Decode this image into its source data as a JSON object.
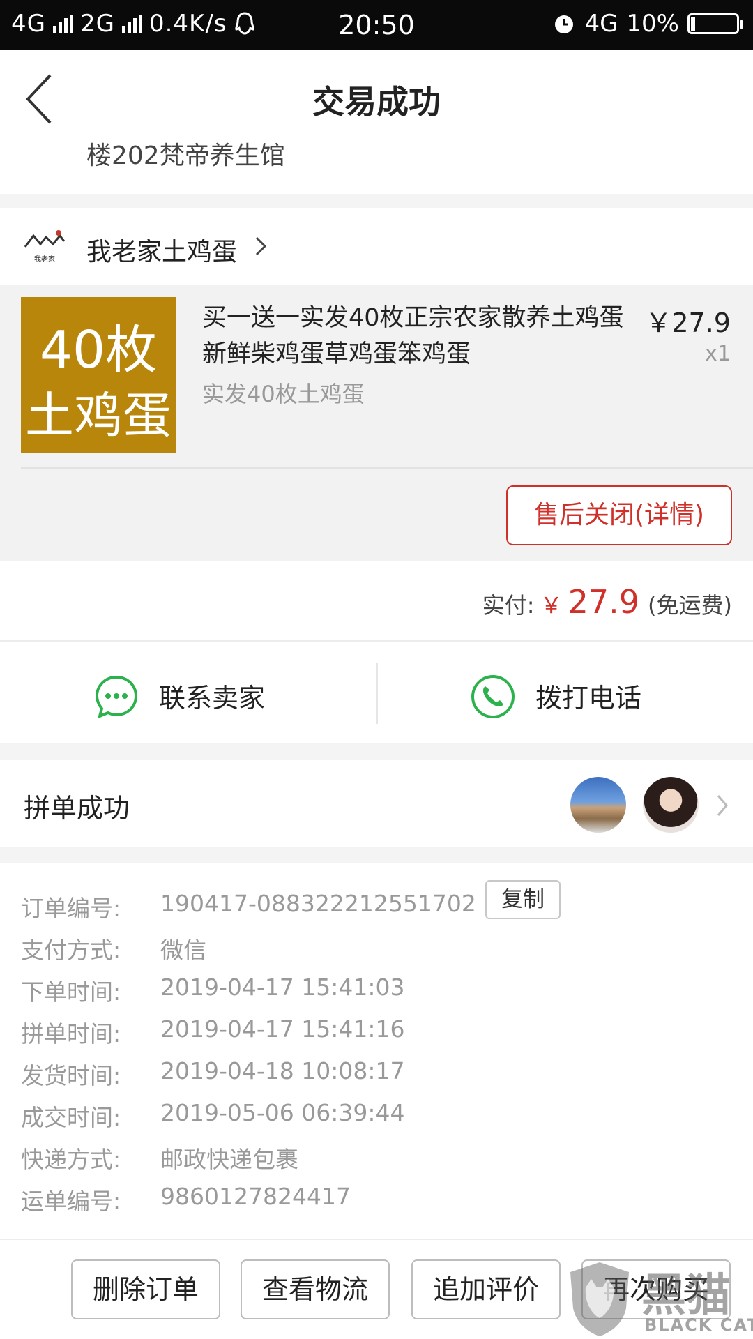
{
  "status_bar": {
    "net1": "4G",
    "net2": "2G",
    "speed": "0.4K/s",
    "time": "20:50",
    "net3": "4G",
    "battery": "10%",
    "battery_level": 0.1
  },
  "nav": {
    "title": "交易成功"
  },
  "address": {
    "tail": "楼202梵帝养生馆"
  },
  "shop": {
    "name": "我老家土鸡蛋",
    "logo_text": "我老家"
  },
  "product": {
    "image_line1": "40枚",
    "image_line2": "土鸡蛋",
    "title": "买一送一实发40枚正宗农家散养土鸡蛋新鲜柴鸡蛋草鸡蛋笨鸡蛋",
    "spec": "实发40枚土鸡蛋",
    "price": "￥27.9",
    "qty": "x1",
    "aftersale_label": "售后关闭(详情)"
  },
  "payment": {
    "label": "实付:",
    "currency": "￥",
    "amount": "27.9",
    "note": "(免运费)",
    "accent_color": "#d0302a"
  },
  "contact": {
    "seller_label": "联系卖家",
    "call_label": "拨打电话",
    "icon_color": "#2bb24c"
  },
  "group": {
    "label": "拼单成功"
  },
  "order_info": {
    "copy_label": "复制",
    "rows": [
      {
        "key": "订单编号:",
        "value": "190417-088322212551702"
      },
      {
        "key": "支付方式:",
        "value": "微信"
      },
      {
        "key": "下单时间:",
        "value": "2019-04-17 15:41:03"
      },
      {
        "key": "拼单时间:",
        "value": "2019-04-17 15:41:16"
      },
      {
        "key": "发货时间:",
        "value": "2019-04-18 10:08:17"
      },
      {
        "key": "成交时间:",
        "value": "2019-05-06 06:39:44"
      },
      {
        "key": "快递方式:",
        "value": "邮政快递包裹"
      },
      {
        "key": "运单编号:",
        "value": "9860127824417"
      }
    ]
  },
  "actions": {
    "delete": "删除订单",
    "logistics": "查看物流",
    "review": "追加评价",
    "rebuy": "再次购买"
  },
  "watermark": {
    "cn": "黑猫",
    "en": "BLACK CAT"
  }
}
